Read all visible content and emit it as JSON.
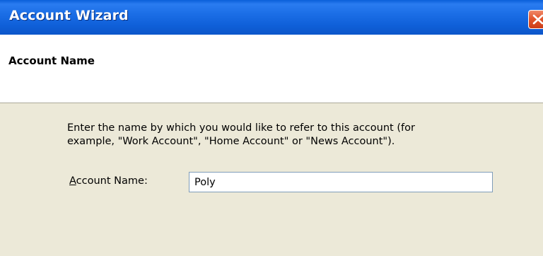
{
  "window": {
    "title": "Account Wizard",
    "close_icon": "close-icon"
  },
  "header": {
    "title": "Account Name"
  },
  "body": {
    "description_line1": "Enter the name by which you would like to refer to this account (for",
    "description_line2": "example, \"Work Account\", \"Home Account\" or \"News Account\").",
    "account_name": {
      "label_accel": "A",
      "label_rest": "ccount Name:",
      "value": "Poly"
    }
  },
  "colors": {
    "titlebar": "#0f5fd8",
    "close_button": "#e2572e",
    "dialog_face": "#ece9d8",
    "header_background": "#ffffff",
    "input_border": "#7f9db9"
  }
}
